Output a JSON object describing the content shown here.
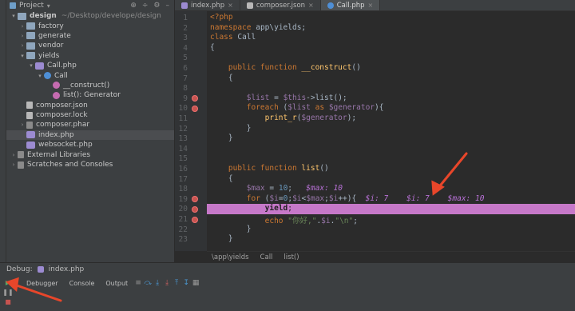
{
  "project_panel": {
    "title": "Project",
    "tree": [
      {
        "label": "design",
        "suffix": "~/Desktop/develope/design",
        "depth": 0,
        "arrow": "▾",
        "icon": "folder",
        "bold": true
      },
      {
        "label": "factory",
        "depth": 1,
        "arrow": "›",
        "icon": "folder"
      },
      {
        "label": "generate",
        "depth": 1,
        "arrow": "›",
        "icon": "folder"
      },
      {
        "label": "vendor",
        "depth": 1,
        "arrow": "›",
        "icon": "folder"
      },
      {
        "label": "yields",
        "depth": 1,
        "arrow": "▾",
        "icon": "folder"
      },
      {
        "label": "Call.php",
        "depth": 2,
        "arrow": "▾",
        "icon": "php"
      },
      {
        "label": "Call",
        "depth": 3,
        "arrow": "▾",
        "icon": "class"
      },
      {
        "label": "__construct()",
        "depth": 4,
        "arrow": "",
        "icon": "method"
      },
      {
        "label": "list(): Generator",
        "depth": 4,
        "arrow": "",
        "icon": "method"
      },
      {
        "label": "composer.json",
        "depth": 1,
        "arrow": "",
        "icon": "json"
      },
      {
        "label": "composer.lock",
        "depth": 1,
        "arrow": "",
        "icon": "json"
      },
      {
        "label": "composer.phar",
        "depth": 1,
        "arrow": "›",
        "icon": "lib"
      },
      {
        "label": "index.php",
        "depth": 1,
        "arrow": "",
        "icon": "php",
        "selected": true
      },
      {
        "label": "websocket.php",
        "depth": 1,
        "arrow": "",
        "icon": "php"
      },
      {
        "label": "External Libraries",
        "depth": 0,
        "arrow": "›",
        "icon": "lib"
      },
      {
        "label": "Scratches and Consoles",
        "depth": 0,
        "arrow": "›",
        "icon": "lib"
      }
    ]
  },
  "editor_tabs": [
    {
      "label": "index.php",
      "active": false,
      "icon": "php"
    },
    {
      "label": "composer.json",
      "active": false,
      "icon": "json"
    },
    {
      "label": "Call.php",
      "active": true,
      "icon": "class"
    }
  ],
  "code": {
    "lines": [
      {
        "n": "1",
        "html": "<span class='tag'>&lt;?php</span>"
      },
      {
        "n": "2",
        "html": "<span class='kw'>namespace</span> <span class='plain'>app\\yields;</span>"
      },
      {
        "n": "3",
        "html": "<span class='kw'>class</span> <span class='plain'>Call</span>"
      },
      {
        "n": "4",
        "html": "<span class='plain'>{</span>"
      },
      {
        "n": "5",
        "html": ""
      },
      {
        "n": "6",
        "html": "    <span class='kw'>public function</span> <span class='fn'>__construct</span><span class='plain'>()</span>"
      },
      {
        "n": "7",
        "html": "    <span class='plain'>{</span>"
      },
      {
        "n": "8",
        "html": ""
      },
      {
        "n": "9",
        "html": "        <span class='var'>$list</span> <span class='plain'>= </span><span class='var'>$this</span><span class='plain'>-&gt;list();</span>"
      },
      {
        "n": "10",
        "html": "        <span class='kw'>foreach</span> <span class='plain'>(</span><span class='var'>$list</span> <span class='kw'>as</span> <span class='var'>$generator</span><span class='plain'>){</span>"
      },
      {
        "n": "11",
        "html": "            <span class='fn'>print_r</span><span class='plain'>(</span><span class='var'>$generator</span><span class='plain'>);</span>"
      },
      {
        "n": "12",
        "html": "        <span class='plain'>}</span>"
      },
      {
        "n": "13",
        "html": "    <span class='plain'>}</span>"
      },
      {
        "n": "14",
        "html": ""
      },
      {
        "n": "15",
        "html": ""
      },
      {
        "n": "16",
        "html": "    <span class='kw'>public function</span> <span class='fn'>list</span><span class='plain'>()</span>"
      },
      {
        "n": "17",
        "html": "    <span class='plain'>{</span>"
      },
      {
        "n": "18",
        "html": "        <span class='var'>$max</span> <span class='plain'>= </span><span class='num'>10</span><span class='plain'>;</span>   <span class='hint'>$max: 10</span>"
      },
      {
        "n": "19",
        "html": "        <span class='kw'>for</span> <span class='plain'>(</span><span class='var'>$i</span><span class='plain'>=</span><span class='num'>0</span><span class='plain'>;</span><span class='var'>$i</span><span class='plain'>&lt;</span><span class='var'>$max</span><span class='plain'>;</span><span class='var'>$i</span><span class='plain'>++){</span>  <span class='hint'>$i: 7</span>    <span class='hint'>$i: 7</span>    <span class='hint'>$max: 10</span>"
      },
      {
        "n": "20",
        "html": "            <span class='kw'>yield</span>;",
        "exec": true
      },
      {
        "n": "21",
        "html": "            <span class='kw'>echo</span> <span class='str'>\"你好,\"</span><span class='plain'>.</span><span class='var'>$i</span><span class='plain'>.</span><span class='str'>\"\\n\"</span><span class='plain'>;</span>"
      },
      {
        "n": "22",
        "html": "        <span class='plain'>}</span>"
      },
      {
        "n": "23",
        "html": "    <span class='plain'>}</span>"
      }
    ],
    "breakpoints": [
      "9",
      "10",
      "19",
      "20",
      "21"
    ]
  },
  "breadcrumb": [
    "\\app\\yields",
    "Call",
    "list()"
  ],
  "debug_panel": {
    "title": "Debug:",
    "config": "index.php",
    "tabs": [
      "Debugger",
      "Console",
      "Output"
    ]
  },
  "colors": {
    "exec_line": "#c678c8",
    "annotation": "#e8462a"
  }
}
